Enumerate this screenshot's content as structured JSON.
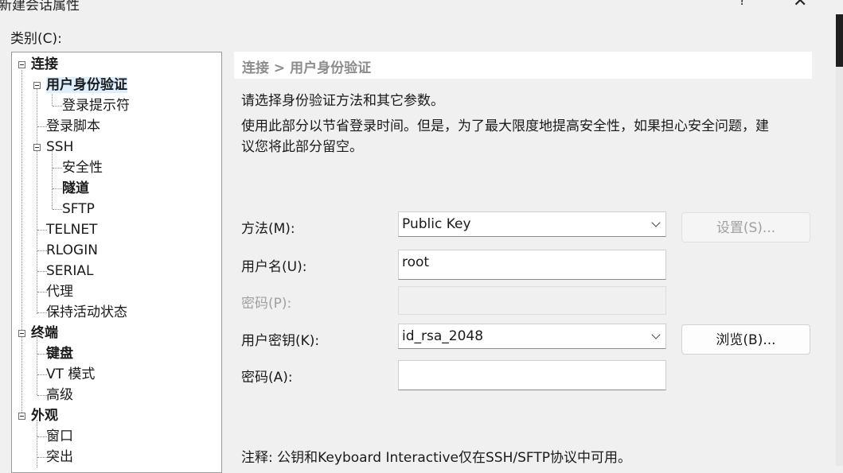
{
  "window": {
    "title": "新建会话属性",
    "help": "?",
    "close": "✕"
  },
  "category_label": "类别(C):",
  "tree": {
    "connection": "连接",
    "auth": "用户身份验证",
    "login_prompt": "登录提示符",
    "login_script": "登录脚本",
    "ssh": "SSH",
    "security": "安全性",
    "tunnel": "隧道",
    "sftp": "SFTP",
    "telnet": "TELNET",
    "rlogin": "RLOGIN",
    "serial": "SERIAL",
    "proxy": "代理",
    "keepalive": "保持活动状态",
    "terminal": "终端",
    "keyboard": "键盘",
    "vt_mode": "VT 模式",
    "advanced": "高级",
    "appearance": "外观",
    "window": "窗口",
    "highlight": "突出"
  },
  "header": {
    "breadcrumb": "连接 > 用户身份验证"
  },
  "description": {
    "line1": "请选择身份验证方法和其它参数。",
    "line2": "使用此部分以节省登录时间。但是，为了最大限度地提高安全性，如果担心安全问题，建",
    "line3": "议您将此部分留空。"
  },
  "form": {
    "method_label": "方法(M):",
    "method_value": "Public Key",
    "settings_button": "设置(S)...",
    "username_label": "用户名(U):",
    "username_value": "root",
    "password_label": "密码(P):",
    "password_value": "",
    "userkey_label": "用户密钥(K):",
    "userkey_value": "id_rsa_2048",
    "browse_button": "浏览(B)...",
    "passphrase_label": "密码(A):",
    "passphrase_value": ""
  },
  "note": "注释: 公钥和Keyboard Interactive仅在SSH/SFTP协议中可用。"
}
